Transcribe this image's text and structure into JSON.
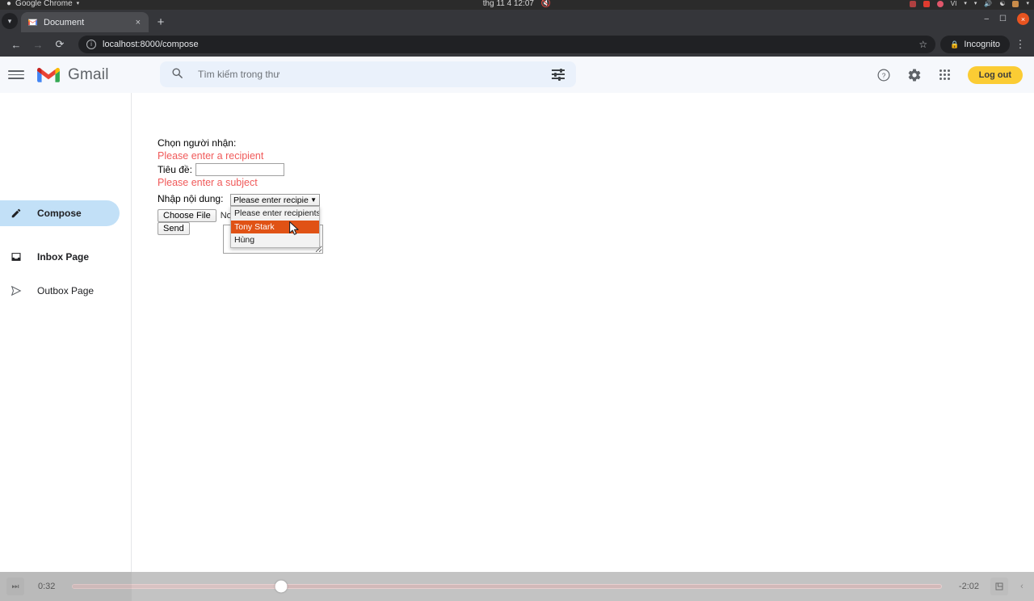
{
  "system_bar": {
    "app_name": "Google Chrome",
    "app_caret": "▾",
    "clock": "thg 11 4  12:07",
    "volume_icon": "volume-muted-icon",
    "tray_items": [
      "record-icon",
      "screen-icon",
      "battery-icon",
      "keyboard-icon",
      "network-icon",
      "volume-icon",
      "power-icon",
      "battery-tray-icon"
    ],
    "language": "VI"
  },
  "browser": {
    "tab_list_icon": "▾",
    "tab": {
      "title": "Document",
      "favicon": "gmail-favicon",
      "close_label": "×"
    },
    "new_tab_label": "+",
    "window_controls": {
      "minimize": "–",
      "maximize": "❐",
      "close": "×"
    },
    "nav": {
      "back": "←",
      "forward": "→",
      "reload": "⟳"
    },
    "omnibox": {
      "info_icon": "ⓘ",
      "url": "localhost:8000/compose",
      "star_icon": "☆"
    },
    "incognito_label": "Incognito",
    "incognito_icon": "🔒",
    "menu_icon": "⋮"
  },
  "gmail": {
    "menu_icon": "hamburger-icon",
    "brand": "Gmail",
    "search": {
      "placeholder": "Tìm kiếm trong thư",
      "value": "",
      "search_icon": "🔍",
      "filter_icon": "tune-icon"
    },
    "help_icon": "?",
    "settings_icon": "⚙",
    "apps_icon": "apps-grid-icon",
    "logout_label": "Log out",
    "logout_color": "#fbcc34"
  },
  "sidebar": {
    "items": [
      {
        "label": "Compose",
        "icon": "✎",
        "active": true
      },
      {
        "label": "Inbox Page",
        "icon": "⬜",
        "active": false
      },
      {
        "label": "Outbox Page",
        "icon": "▷",
        "active": false
      }
    ],
    "active_bg": "#c2e0f7"
  },
  "compose": {
    "recipient_label": "Chọn người nhận:",
    "recipient_selected": "Please enter recipients",
    "recipient_options": [
      {
        "label": "Please enter recipients",
        "highlighted": false
      },
      {
        "label": "Tony Stark",
        "highlighted": true
      },
      {
        "label": "Hùng",
        "highlighted": false
      }
    ],
    "recipient_error": "Please enter a recipient",
    "subject_label": "Tiêu đề:",
    "subject_value": "",
    "subject_error": "Please enter a subject",
    "body_label": "Nhập nội dung:",
    "body_value": "",
    "choose_file_label": "Choose File",
    "no_file_label": "No file chosen",
    "send_label": "Send",
    "error_color": "#f05a5a",
    "highlight_color": "#e05215",
    "dropdown_chevron": "⌄"
  },
  "video_controls": {
    "skip_icon": "⏭",
    "current_time": "0:32",
    "remaining_time": "-2:02",
    "progress_percent": 24,
    "fullscreen_icon": "⇱",
    "overflow_icon": "‹"
  }
}
